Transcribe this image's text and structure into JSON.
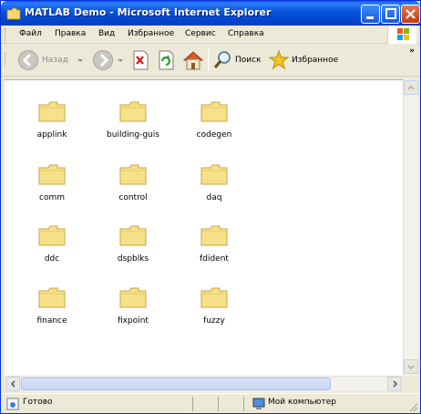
{
  "window": {
    "title": "MATLAB Demo - Microsoft Internet Explorer"
  },
  "menu": {
    "items": [
      "Файл",
      "Правка",
      "Вид",
      "Избранное",
      "Сервис",
      "Справка"
    ]
  },
  "toolbar": {
    "back_label": "Назад",
    "search_label": "Поиск",
    "favorites_label": "Избранное",
    "overflow": "»"
  },
  "folders": [
    {
      "name": "applink"
    },
    {
      "name": "building-guis"
    },
    {
      "name": "codegen"
    },
    {
      "name": "comm"
    },
    {
      "name": "control"
    },
    {
      "name": "daq"
    },
    {
      "name": "ddc"
    },
    {
      "name": "dspblks"
    },
    {
      "name": "fdident"
    },
    {
      "name": "finance"
    },
    {
      "name": "fixpoint"
    },
    {
      "name": "fuzzy"
    }
  ],
  "status": {
    "text": "Готово",
    "zone": "Мой компьютер"
  },
  "colors": {
    "titlebar": "#0753DC",
    "folder_fill": "#F7E08A",
    "folder_edge": "#C8A640",
    "chrome": "#ECE9D8"
  }
}
